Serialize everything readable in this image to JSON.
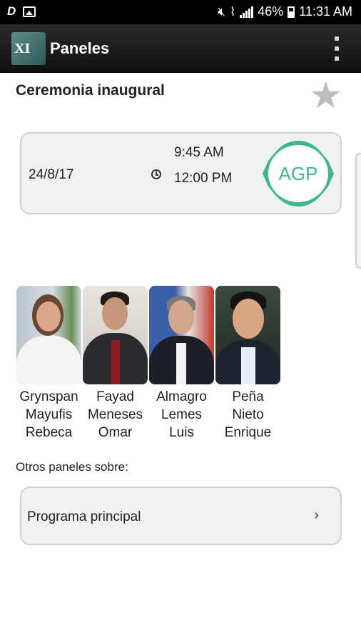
{
  "status_bar": {
    "battery": "46%",
    "time": "11:31 AM",
    "icons": [
      "app-notification-icon",
      "image-icon",
      "mute-icon",
      "wifi-icon",
      "signal-icon",
      "battery-icon"
    ]
  },
  "app_bar": {
    "logo_text": "XI",
    "title": "Paneles",
    "menu_icon": "overflow-menu-icon"
  },
  "panel": {
    "title": "Ceremonia inaugural",
    "favorite_icon": "star-icon",
    "date": "24/8/17",
    "time_start": "9:45 AM",
    "time_end": "12:00 PM",
    "badge": "AGP",
    "badge_color": "#3fb68c"
  },
  "speakers": [
    {
      "name": [
        "Grynspan",
        "Mayufis",
        "Rebeca"
      ]
    },
    {
      "name": [
        "Fayad",
        "Meneses",
        "Omar"
      ]
    },
    {
      "name": [
        "Almagro",
        "Lemes",
        "Luis"
      ]
    },
    {
      "name": [
        "Peña",
        "Nieto",
        "Enrique"
      ]
    }
  ],
  "others": {
    "label": "Otros paneles sobre:",
    "items": [
      {
        "label": "Programa principal"
      }
    ]
  }
}
